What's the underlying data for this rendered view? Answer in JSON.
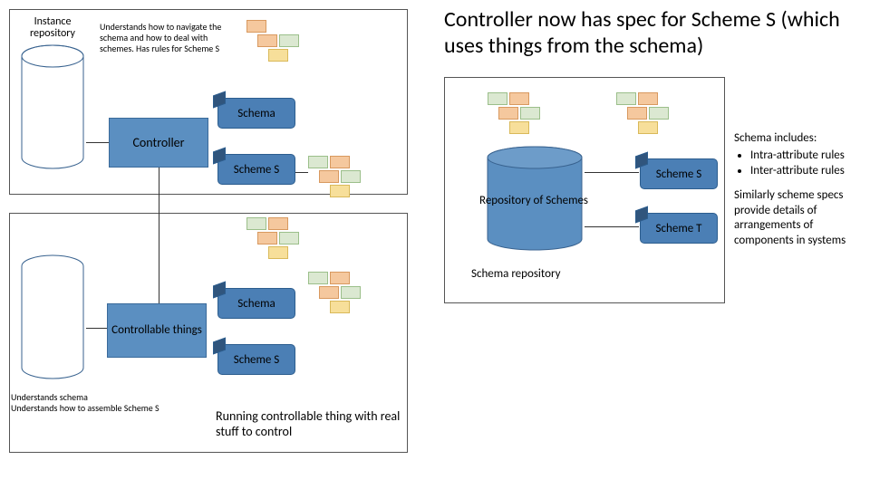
{
  "title": "Controller now has spec for Scheme S (which uses things from the schema)",
  "labels": {
    "instance_repository": "Instance repository",
    "controller_desc": "Understands how to navigate the schema and how to deal with schemes. Has rules for Scheme S",
    "controller": "Controller",
    "controllable_things": "Controllable things",
    "schema": "Schema",
    "scheme_s": "Scheme S",
    "scheme_t": "Scheme T",
    "repository_of_schemes": "Repository of Schemes",
    "schema_repository": "Schema repository",
    "understands_footnote": "Understands schema\nUnderstands how to assemble Scheme S",
    "running_controllable": "Running controllable thing with real stuff to control"
  },
  "side_notes": {
    "schema_includes_heading": "Schema includes:",
    "schema_includes_items": [
      "Intra-attribute rules",
      "Inter-attribute rules"
    ],
    "similarly": "Similarly scheme specs provide details of arrangements of components in systems"
  },
  "colors": {
    "box_fill": "#5b8fc1",
    "tablet_fill": "#4b7fb5",
    "cylinder_fill": "#5b8fc1"
  }
}
